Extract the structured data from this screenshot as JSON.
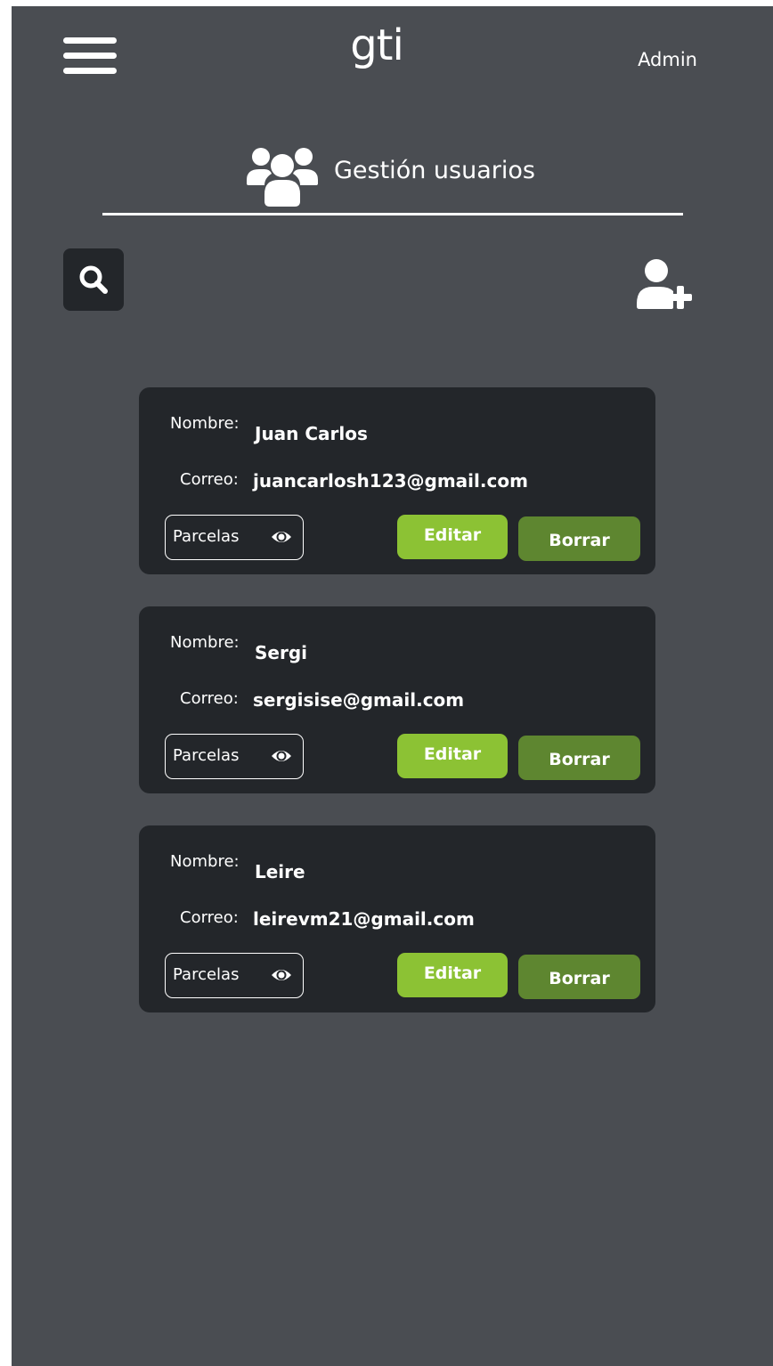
{
  "header": {
    "logo": "gti",
    "user_role": "Admin"
  },
  "page": {
    "title": "Gestión usuarios"
  },
  "labels": {
    "nombre": "Nombre:",
    "correo": "Correo:",
    "parcelas": "Parcelas",
    "editar": "Editar",
    "borrar": "Borrar"
  },
  "users": [
    {
      "nombre": "Juan Carlos",
      "correo": "juancarlosh123@gmail.com"
    },
    {
      "nombre": "Sergi",
      "correo": "sergisise@gmail.com"
    },
    {
      "nombre": "Leire",
      "correo": "leirevm21@gmail.com"
    }
  ],
  "colors": {
    "background": "#4a4d52",
    "card": "#23262a",
    "editar": "#8cc234",
    "borrar": "#5e8630"
  },
  "icons": {
    "menu": "hamburger-menu-icon",
    "page": "users-group-icon",
    "search": "search-icon",
    "add_user": "add-user-icon",
    "parcelas": "eye-icon"
  }
}
